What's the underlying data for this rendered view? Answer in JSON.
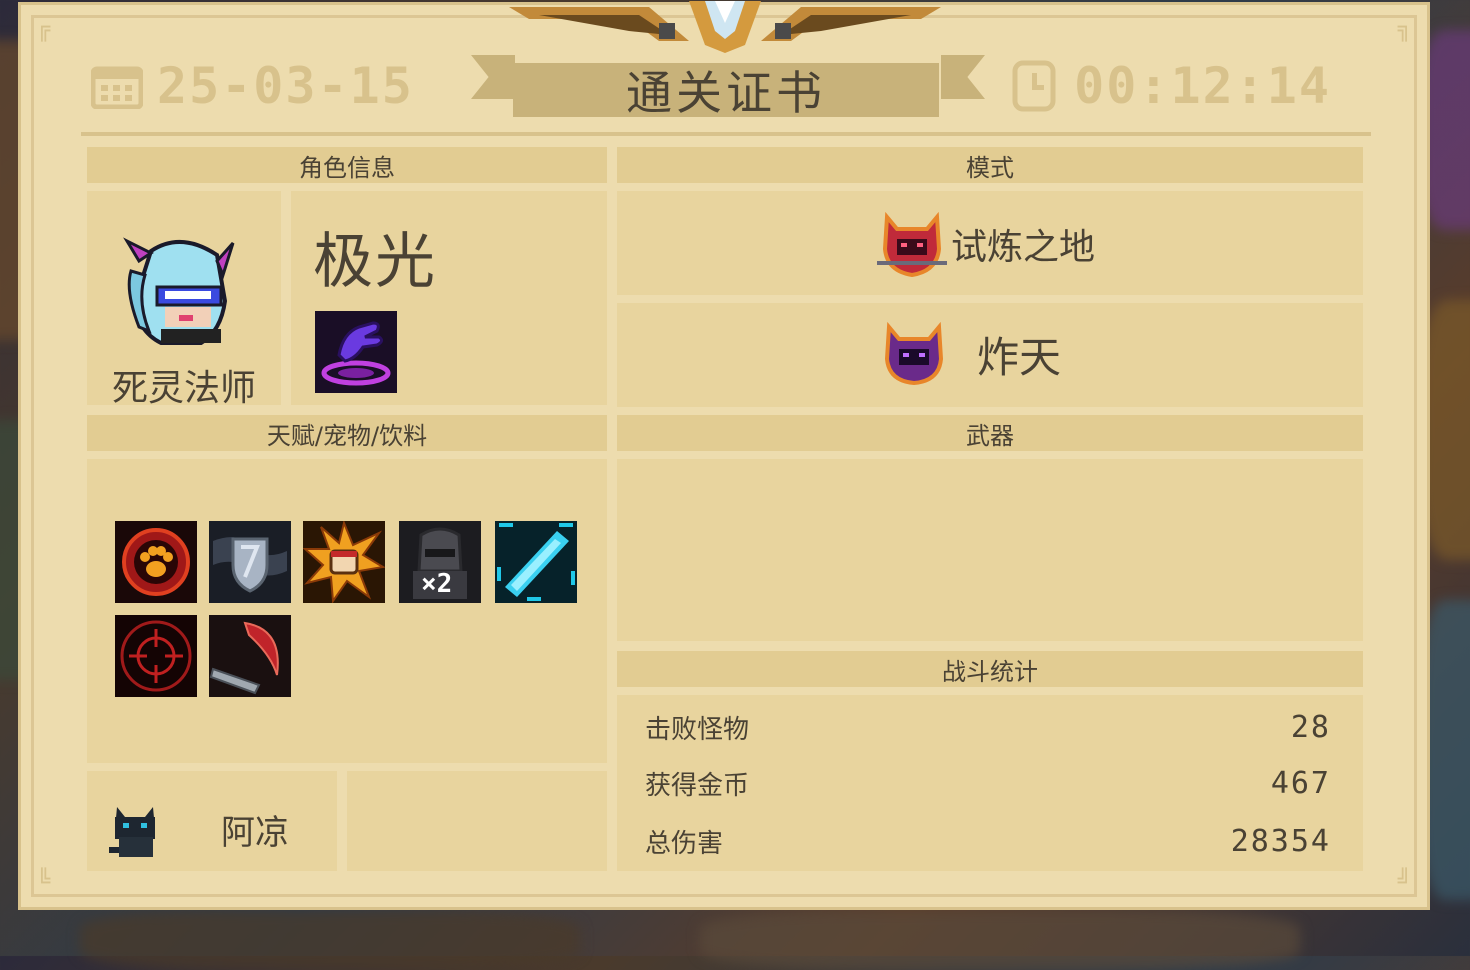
{
  "header": {
    "date": "25-03-15",
    "time": "00:12:14",
    "title": "通关证书"
  },
  "character": {
    "section_title": "角色信息",
    "class_name": "死灵法师",
    "skin_name": "极光",
    "skill_icon": "purple-hand-summon-icon"
  },
  "mode": {
    "section_title": "模式",
    "items": [
      {
        "label": "试炼之地",
        "icon": "red-demon-helmet-icon"
      },
      {
        "label": "炸天",
        "icon": "purple-demon-helmet-icon"
      }
    ]
  },
  "buffs": {
    "section_title": "天赋/宠物/饮料",
    "icons": [
      "paw-print-icon",
      "shield-icon",
      "power-fist-icon",
      "knight-x2-icon",
      "blue-blade-icon",
      "crosshair-icon",
      "sickle-icon"
    ],
    "knight_badge": "×2"
  },
  "weapons": {
    "section_title": "武器"
  },
  "pet": {
    "name": "阿凉",
    "icon": "black-cat-icon"
  },
  "stats": {
    "section_title": "战斗统计",
    "rows": [
      {
        "label": "击败怪物",
        "value": "28"
      },
      {
        "label": "获得金币",
        "value": "467"
      },
      {
        "label": "总伤害",
        "value": "28354"
      }
    ]
  },
  "colors": {
    "card_bg": "#eddcae",
    "panel_bg": "#e8d49e",
    "accent": "#c8b27a",
    "text": "#4a4234"
  }
}
